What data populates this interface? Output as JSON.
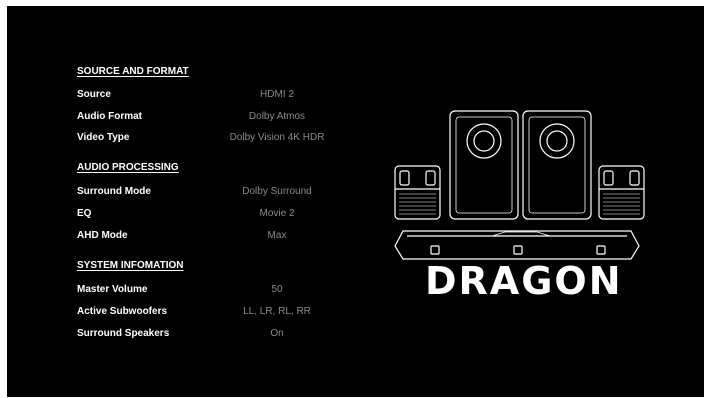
{
  "sections": [
    {
      "title": "SOURCE AND FORMAT",
      "rows": [
        {
          "label": "Source",
          "value": "HDMI 2"
        },
        {
          "label": "Audio Format",
          "value": "Dolby Atmos"
        },
        {
          "label": "Video Type",
          "value": "Dolby Vision 4K HDR"
        }
      ]
    },
    {
      "title": "AUDIO PROCESSING",
      "rows": [
        {
          "label": "Surround Mode",
          "value": "Dolby Surround"
        },
        {
          "label": "EQ",
          "value": "Movie 2"
        },
        {
          "label": "AHD Mode",
          "value": "Max"
        }
      ]
    },
    {
      "title": "SYSTEM INFOMATION",
      "rows": [
        {
          "label": "Master Volume",
          "value": "50"
        },
        {
          "label": "Active Subwoofers",
          "value": "LL, LR, RL, RR"
        },
        {
          "label": "Surround Speakers",
          "value": "On"
        }
      ]
    }
  ],
  "brand": {
    "name": "DRAGON"
  },
  "colors": {
    "background": "#000000",
    "label": "#ffffff",
    "value": "#8a8a8a"
  },
  "icons": [
    "speaker-system-icon"
  ]
}
